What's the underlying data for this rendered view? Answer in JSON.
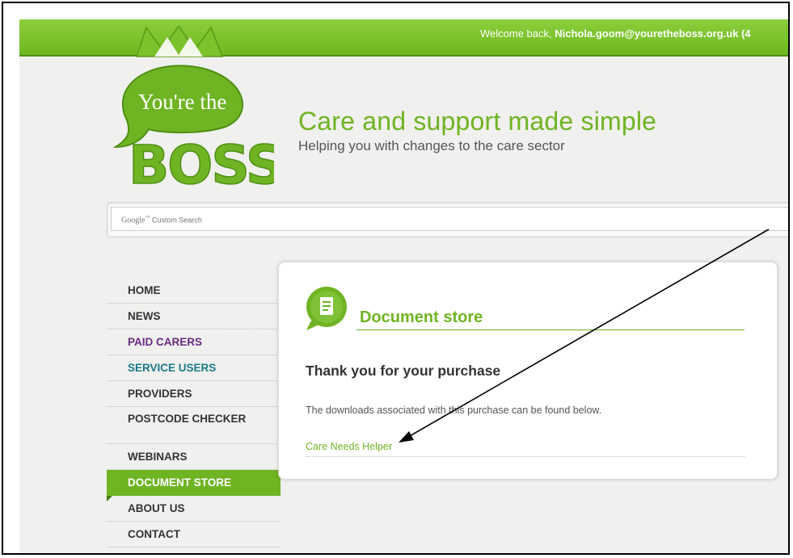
{
  "header": {
    "welcome_prefix": "Welcome back, ",
    "user_email": "Nichola.goom@youretheboss.org.uk (4"
  },
  "logo": {
    "line1": "You're the",
    "line2": "BOSS"
  },
  "tagline": {
    "title": "Care and support made simple",
    "subtitle": "Helping you with changes to the care sector"
  },
  "search": {
    "brand": "Google",
    "tm": "™",
    "label": "Custom Search"
  },
  "nav": {
    "items": [
      {
        "label": "HOME"
      },
      {
        "label": "NEWS"
      },
      {
        "label": "PAID CARERS"
      },
      {
        "label": "SERVICE USERS"
      },
      {
        "label": "PROVIDERS"
      },
      {
        "label": "POSTCODE CHECKER"
      },
      {
        "label": "WEBINARS"
      },
      {
        "label": "DOCUMENT STORE"
      },
      {
        "label": "ABOUT US"
      },
      {
        "label": "CONTACT"
      }
    ],
    "active": "DOCUMENT STORE"
  },
  "panel": {
    "title": "Document store",
    "heading": "Thank you for your purchase",
    "body": "The downloads associated with this purchase can be found below.",
    "download_link": "Care Needs Helper"
  },
  "colors": {
    "brand_green": "#6fb423",
    "top_bar": "#7bc22c",
    "paid_carers": "#6a2a80",
    "service_users": "#1a7a8a"
  },
  "icons": {
    "logo": "crown-speech-bubble-logo",
    "panel": "document-speech-bubble-icon"
  }
}
